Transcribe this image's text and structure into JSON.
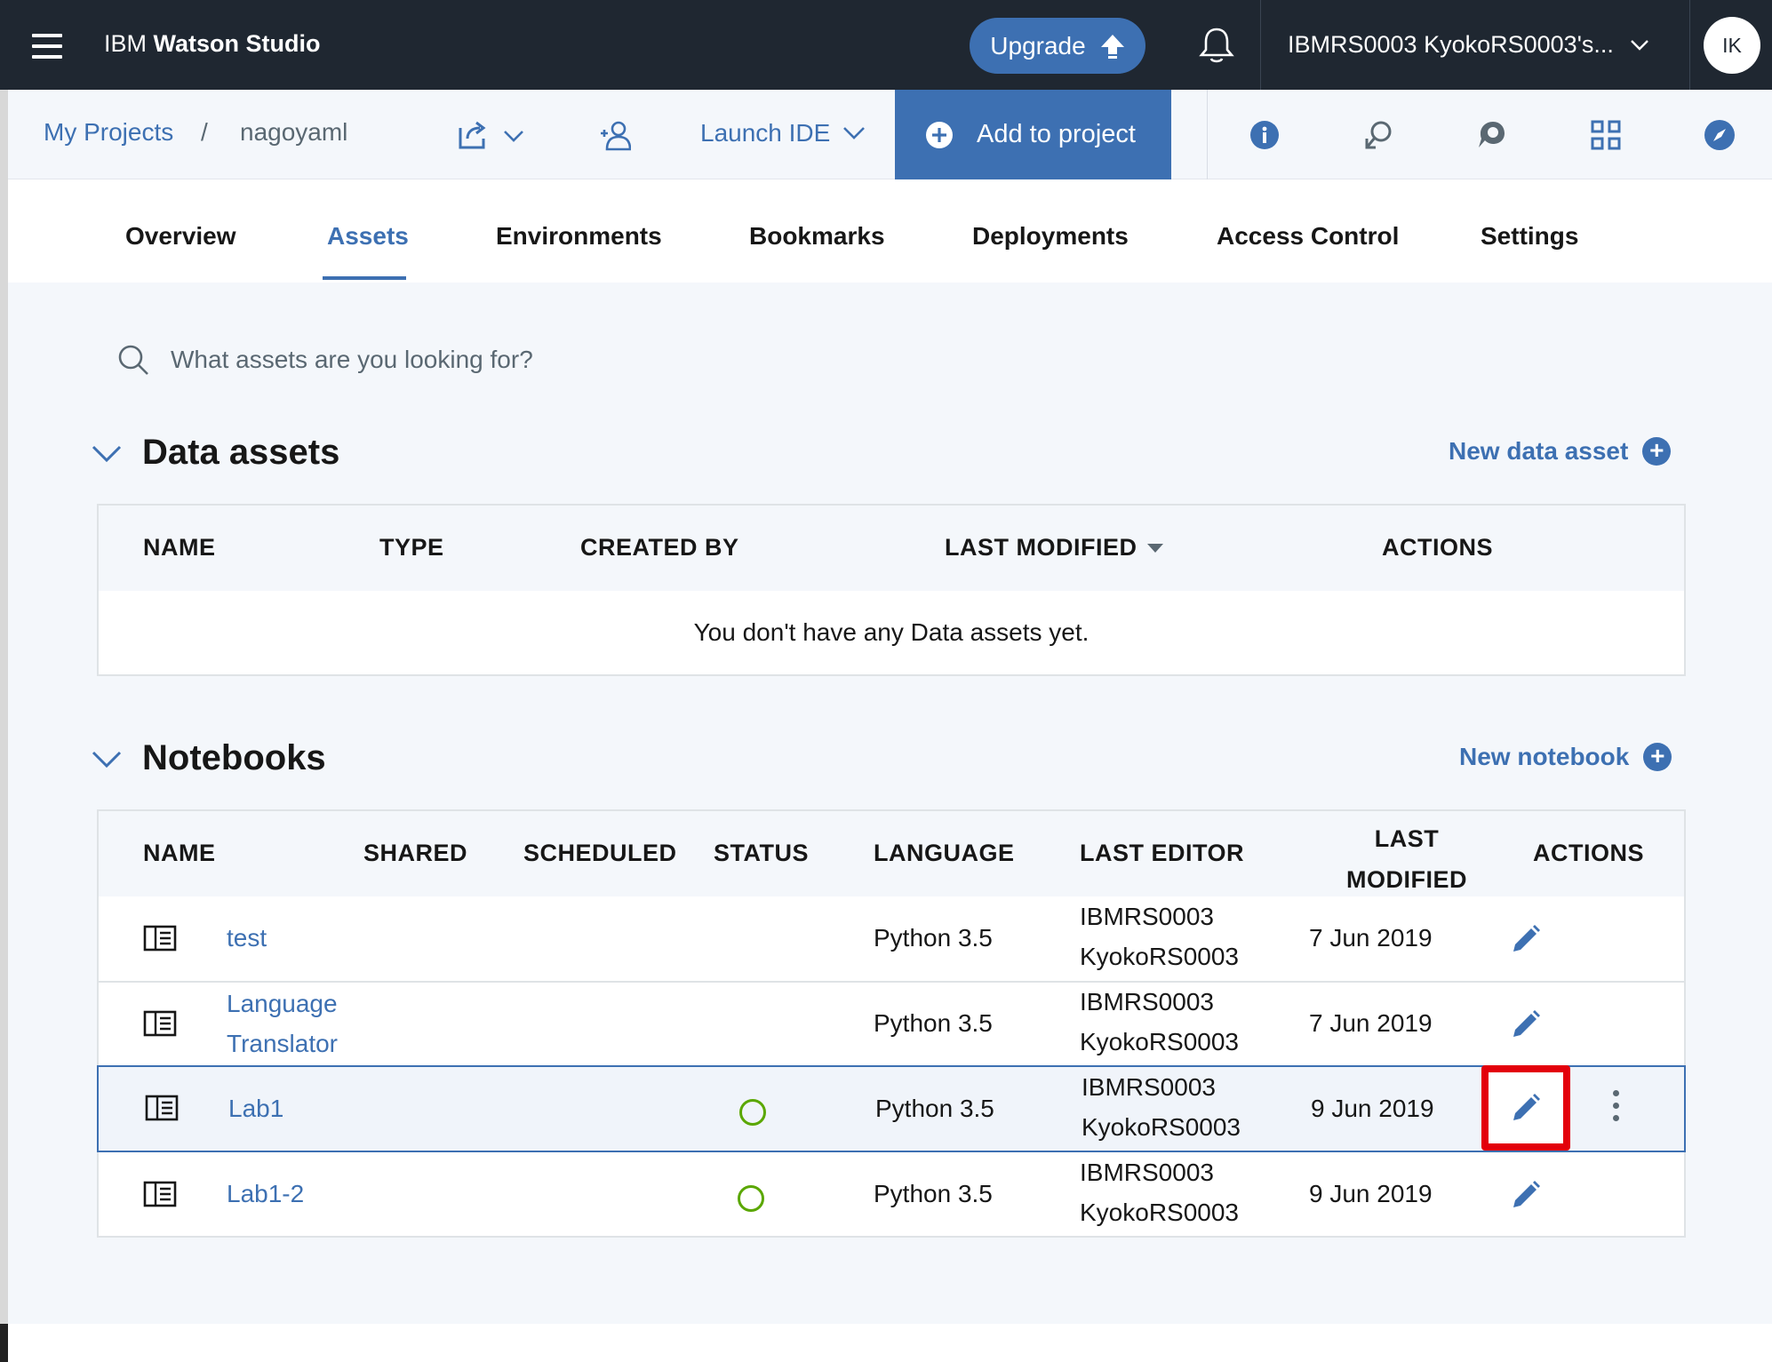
{
  "topbar": {
    "brand_prefix": "IBM",
    "brand_product": "Watson Studio",
    "upgrade_label": "Upgrade",
    "account_label": "IBMRS0003 KyokoRS0003's...",
    "avatar_initials": "IK"
  },
  "projectbar": {
    "breadcrumb_root": "My Projects",
    "breadcrumb_sep": "/",
    "project_name": "nagoyaml",
    "launch_ide_label": "Launch IDE",
    "add_to_project_label": "Add to project"
  },
  "tabs": [
    "Overview",
    "Assets",
    "Environments",
    "Bookmarks",
    "Deployments",
    "Access Control",
    "Settings"
  ],
  "search": {
    "placeholder": "What assets are you looking for?"
  },
  "data_assets": {
    "title": "Data assets",
    "new_label": "New data asset",
    "columns": [
      "NAME",
      "TYPE",
      "CREATED BY",
      "LAST MODIFIED",
      "ACTIONS"
    ],
    "empty_message": "You don't have any Data assets yet."
  },
  "notebooks": {
    "title": "Notebooks",
    "new_label": "New notebook",
    "columns": [
      "NAME",
      "SHARED",
      "SCHEDULED",
      "STATUS",
      "LANGUAGE",
      "LAST EDITOR",
      "LAST",
      "MODIFIED",
      "ACTIONS"
    ],
    "rows": [
      {
        "name_l1": "test",
        "name_l2": "",
        "language": "Python 3.5",
        "editor_l1": "IBMRS0003",
        "editor_l2": "KyokoRS0003",
        "modified": "7 Jun 2019"
      },
      {
        "name_l1": "Language",
        "name_l2": "Translator",
        "language": "Python 3.5",
        "editor_l1": "IBMRS0003",
        "editor_l2": "KyokoRS0003",
        "modified": "7 Jun 2019"
      },
      {
        "name_l1": "Lab1",
        "name_l2": "",
        "language": "Python 3.5",
        "editor_l1": "IBMRS0003",
        "editor_l2": "KyokoRS0003",
        "modified": "9 Jun 2019"
      },
      {
        "name_l1": "Lab1-2",
        "name_l2": "",
        "language": "Python 3.5",
        "editor_l1": "IBMRS0003",
        "editor_l2": "KyokoRS0003",
        "modified": "9 Jun 2019"
      }
    ]
  },
  "colors": {
    "accent": "#3d70b2",
    "topbar": "#1f2731",
    "status_ok": "#5aa700",
    "highlight": "#e3000b"
  },
  "icons": [
    "hamburger-icon",
    "upload-arrow-icon",
    "bell-icon",
    "chevron-down-icon",
    "share-arrow-icon",
    "add-collaborator-icon",
    "plus-circle-icon",
    "info-icon",
    "pin-icon",
    "chat-icon",
    "grid-icon",
    "compass-icon",
    "search-icon",
    "notebook-icon",
    "pencil-icon",
    "kebab-icon",
    "status-circle-icon"
  ]
}
